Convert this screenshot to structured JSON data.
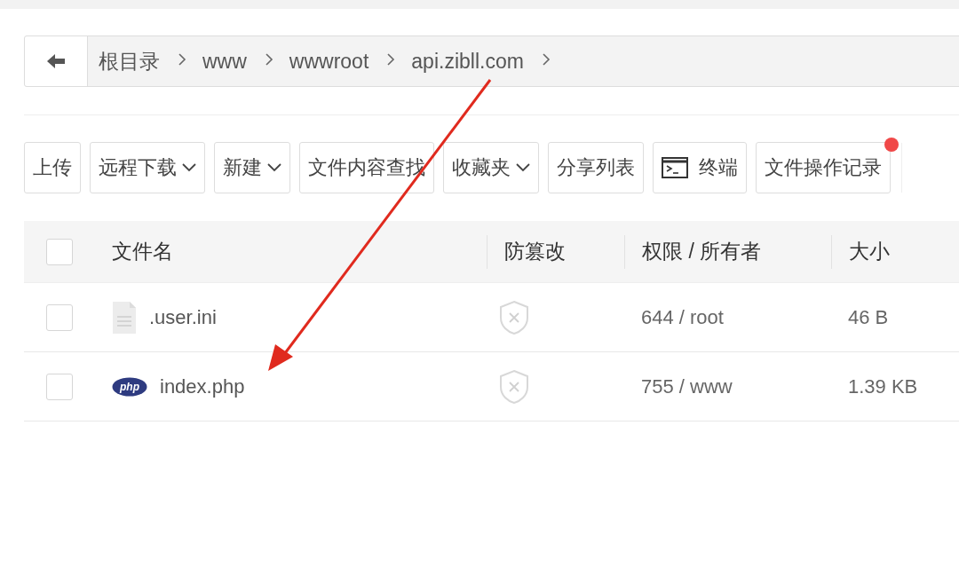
{
  "breadcrumb": [
    {
      "label": "根目录"
    },
    {
      "label": "www"
    },
    {
      "label": "wwwroot"
    },
    {
      "label": "api.zibll.com"
    }
  ],
  "toolbar": [
    {
      "label": "上传",
      "kind": "plain",
      "dropdown": false,
      "notification": false
    },
    {
      "label": "远程下载",
      "kind": "plain",
      "dropdown": true,
      "notification": false
    },
    {
      "label": "新建",
      "kind": "plain",
      "dropdown": true,
      "notification": false
    },
    {
      "label": "文件内容查找",
      "kind": "plain",
      "dropdown": false,
      "notification": false
    },
    {
      "label": "收藏夹",
      "kind": "plain",
      "dropdown": true,
      "notification": false
    },
    {
      "label": "分享列表",
      "kind": "plain",
      "dropdown": false,
      "notification": false
    },
    {
      "label": "终端",
      "kind": "terminal",
      "dropdown": false,
      "notification": false
    },
    {
      "label": "文件操作记录",
      "kind": "plain",
      "dropdown": false,
      "notification": true
    }
  ],
  "table": {
    "select_all_checked": false,
    "columns": [
      "文件名",
      "防篡改",
      "权限 / 所有者",
      "大小"
    ],
    "rows": [
      {
        "name": ".user.ini",
        "kind": "text",
        "checked": false,
        "protected": false,
        "permissions": "644 / root",
        "size": "46 B"
      },
      {
        "name": "index.php",
        "kind": "php",
        "icon_label": "php",
        "checked": false,
        "protected": false,
        "permissions": "755 / www",
        "size": "1.39 KB"
      }
    ]
  }
}
